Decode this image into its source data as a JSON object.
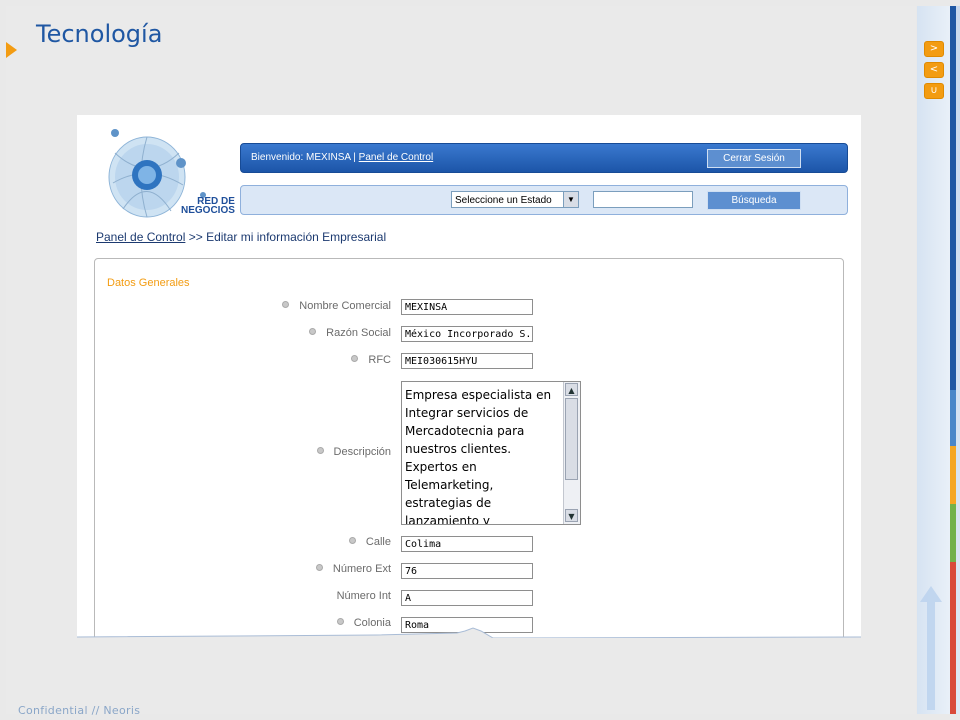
{
  "slide": {
    "title": "Tecnología",
    "footer": "Confidential  //  Neoris",
    "nav": {
      "next": ">",
      "prev": "<",
      "return": "∪"
    }
  },
  "app": {
    "logo": {
      "line1": "RED DE",
      "line2": "NEGOCIOS"
    },
    "welcome": {
      "prefix": "Bienvenido: MEXINSA",
      "separator": "|",
      "link": "Panel de Control"
    },
    "logout_label": "Cerrar Sesión",
    "search": {
      "state_selected": "Seleccione un Estado",
      "input_value": "",
      "button_label": "Búsqueda"
    },
    "breadcrumb": {
      "link": "Panel de Control",
      "current": ">> Editar mi información Empresarial"
    },
    "form": {
      "title": "Datos Generales",
      "fields": {
        "nombre_comercial": {
          "label": "Nombre Comercial",
          "value": "MEXINSA"
        },
        "razon_social": {
          "label": "Razón Social",
          "value": "México Incorporado S."
        },
        "rfc": {
          "label": "RFC",
          "value": "MEI030615HYU"
        },
        "descripcion": {
          "label": "Descripción",
          "value": "Empresa especialista en Integrar servicios de Mercadotecnia para nuestros clientes. Expertos en Telemarketing, estrategias de lanzamiento y"
        },
        "calle": {
          "label": "Calle",
          "value": "Colima"
        },
        "numero_ext": {
          "label": "Número Ext",
          "value": "76"
        },
        "numero_int": {
          "label": "Número Int",
          "value": "A"
        },
        "colonia": {
          "label": "Colonia",
          "value": "Roma"
        }
      }
    }
  },
  "colors": {
    "title": "#1f57a3",
    "accent": "#f39c12",
    "header_blue": "#1c55a8",
    "form_label": "#6b6b6b"
  }
}
